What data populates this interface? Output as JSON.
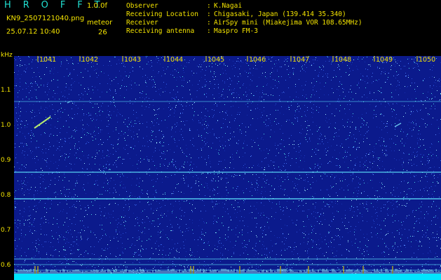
{
  "header": {
    "title": "H R O F F T",
    "version": "1.0.0f",
    "filename": "KN9_2507121040.png",
    "datetime": "25.07.12 10:40",
    "meteor_label": "meteor",
    "meteor_count": "26"
  },
  "info": [
    {
      "key": "Observer",
      "value": "K.Nagai"
    },
    {
      "key": "Receiving Location",
      "value": "Chigasaki, Japan (139.414 35.340)"
    },
    {
      "key": "Receiver",
      "value": "AirSpy mini (Miakejima VOR 108.65MHz)"
    },
    {
      "key": "Receiving antenna",
      "value": "Maspro FM-3"
    }
  ],
  "axes": {
    "y_unit": "kHz",
    "y_ticks": [
      "1.1",
      "1.0",
      "0.9",
      "0.8",
      "0.7",
      "0.6"
    ],
    "x_ticks": [
      "1041",
      "1042",
      "1043",
      "1044",
      "1045",
      "1046",
      "1047",
      "1048",
      "1049",
      "1050"
    ]
  },
  "colors": {
    "background": "#0b1a8c",
    "label": "#f4e400",
    "title": "#21e0d2",
    "signal": "#5fe7ff",
    "baseline": "#00e5ff"
  }
}
